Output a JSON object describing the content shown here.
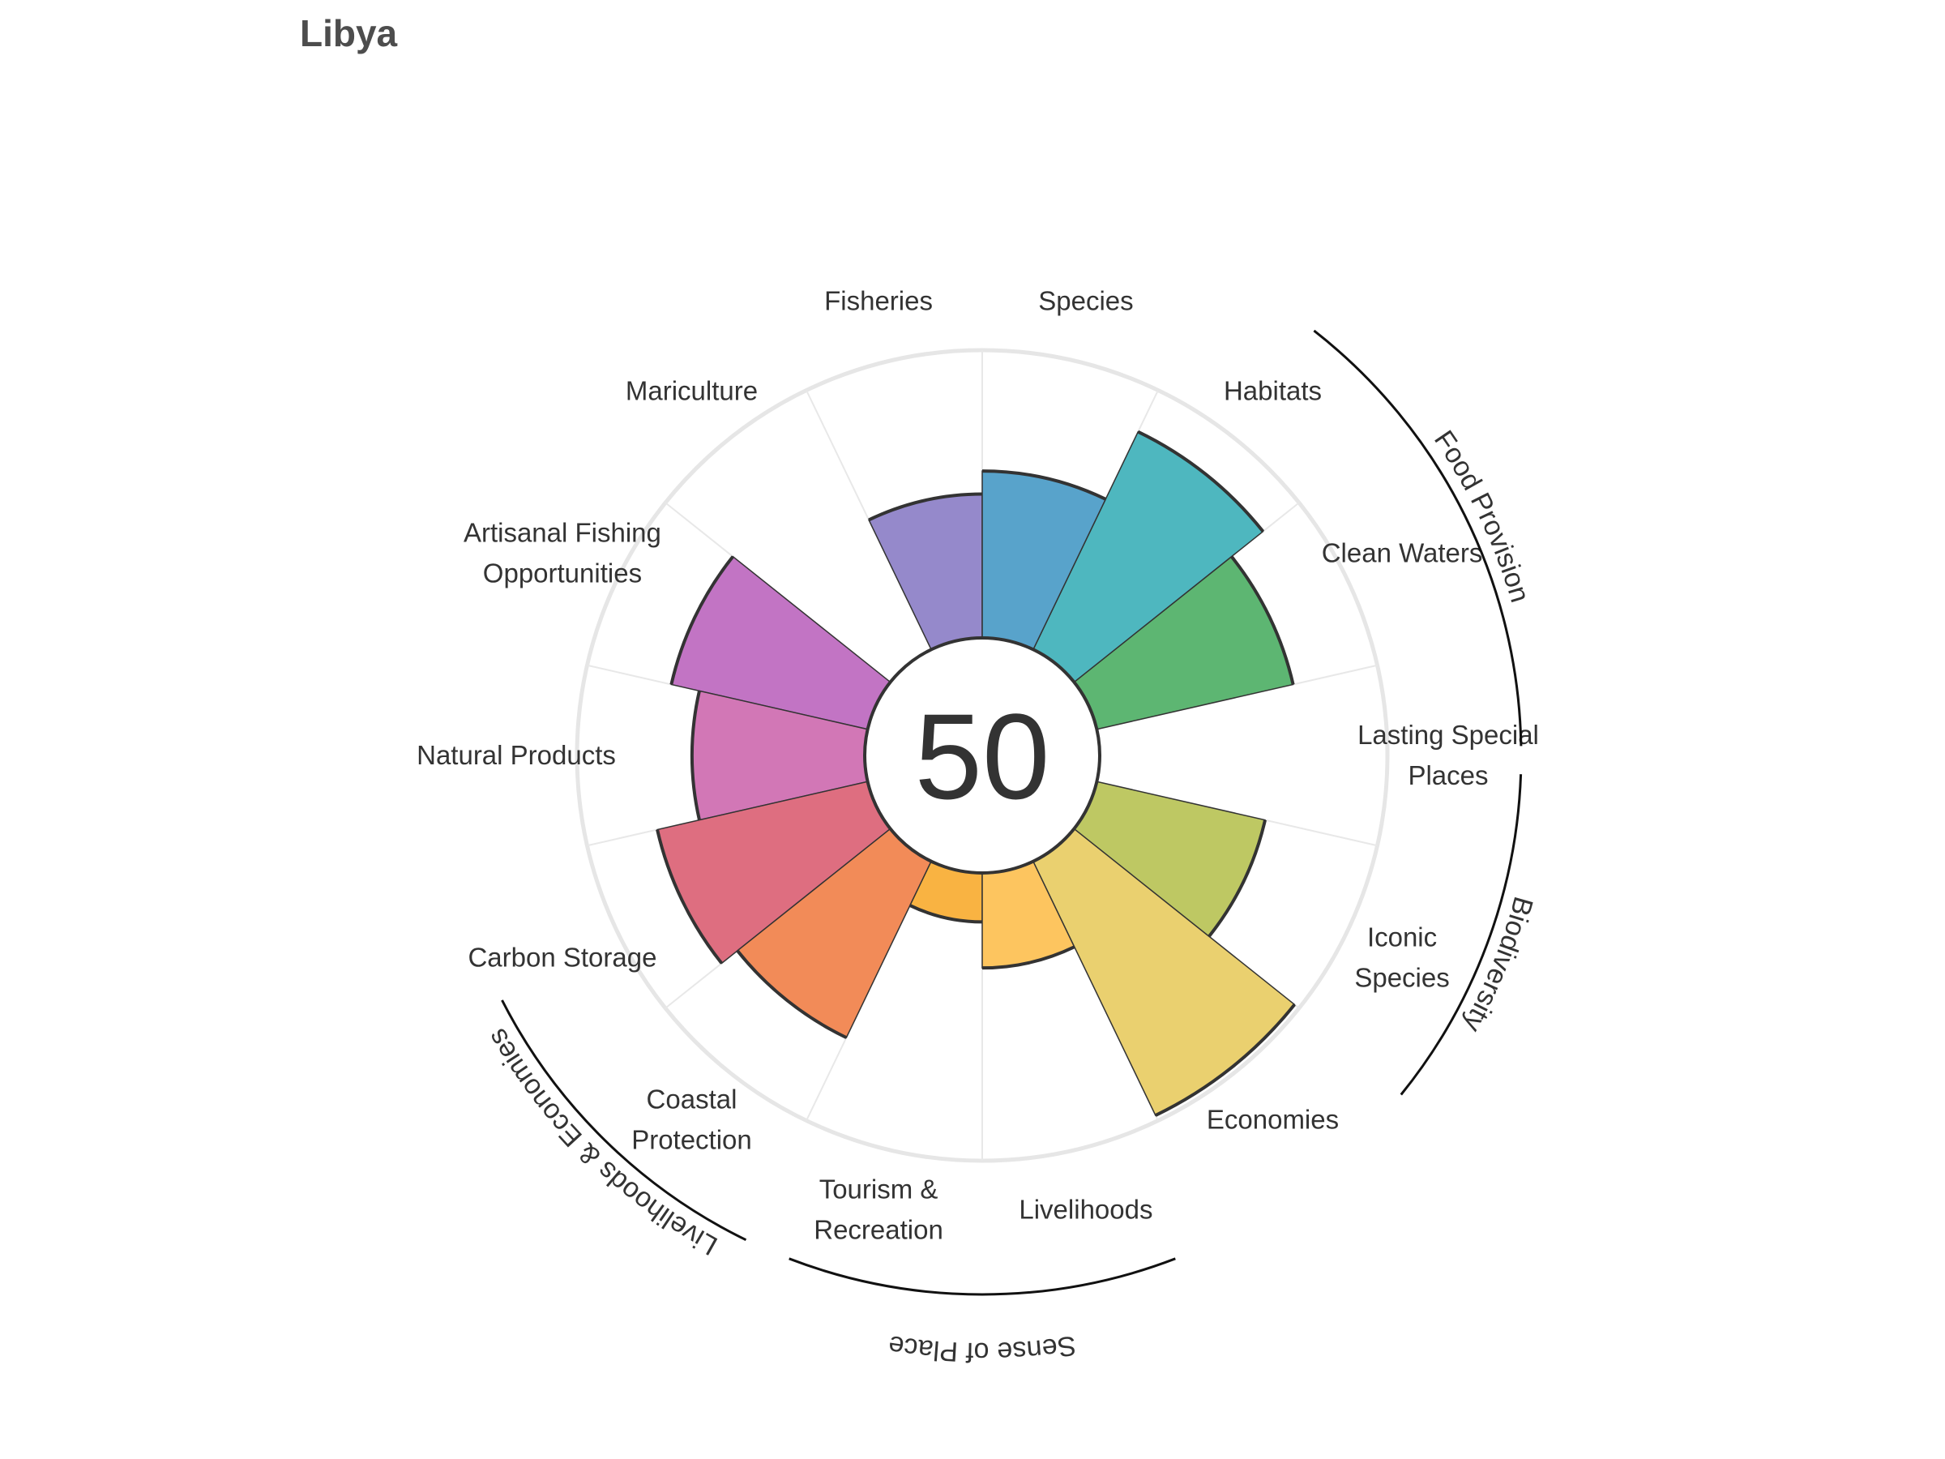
{
  "title": "Libya",
  "chart_data": {
    "type": "polar-bar",
    "title": "Libya",
    "center_score": "50",
    "ylim": [
      0,
      100
    ],
    "goals": [
      {
        "label": [
          "Fisheries"
        ],
        "value": 50,
        "color": "#9589cb",
        "group": "Food Provision"
      },
      {
        "label": [
          "Mariculture"
        ],
        "value": 0,
        "color": "#a78bcc",
        "group": "Food Provision"
      },
      {
        "label": [
          "Artisanal Fishing",
          "Opportunities"
        ],
        "value": 70,
        "color": "#c274c4",
        "group": null
      },
      {
        "label": [
          "Natural Products"
        ],
        "value": 60,
        "color": "#d277b6",
        "group": null
      },
      {
        "label": [
          "Carbon Storage"
        ],
        "value": 75,
        "color": "#de6e80",
        "group": null
      },
      {
        "label": [
          "Coastal",
          "Protection"
        ],
        "value": 68,
        "color": "#f28b58",
        "group": null
      },
      {
        "label": [
          "Tourism &",
          "Recreation"
        ],
        "value": 17,
        "color": "#f9b342",
        "group": null
      },
      {
        "label": [
          "Livelihoods"
        ],
        "value": 33,
        "color": "#fdc55f",
        "group": "Livelihoods & Economies"
      },
      {
        "label": [
          "Economies"
        ],
        "value": 98,
        "color": "#ead06f",
        "group": "Livelihoods & Economies"
      },
      {
        "label": [
          "Iconic",
          "Species"
        ],
        "value": 60,
        "color": "#bec863",
        "group": "Sense of Place"
      },
      {
        "label": [
          "Lasting Special",
          "Places"
        ],
        "value": 0,
        "color": "#8cc36a",
        "group": "Sense of Place"
      },
      {
        "label": [
          "Clean Waters"
        ],
        "value": 70,
        "color": "#5db672",
        "group": null
      },
      {
        "label": [
          "Habitats"
        ],
        "value": 84,
        "color": "#4eb7bf",
        "group": "Biodiversity"
      },
      {
        "label": [
          "Species"
        ],
        "value": 58,
        "color": "#58a3cb",
        "group": "Biodiversity"
      }
    ],
    "groups": [
      "Food Provision",
      "Biodiversity",
      "Sense of Place",
      "Livelihoods & Economies"
    ]
  }
}
